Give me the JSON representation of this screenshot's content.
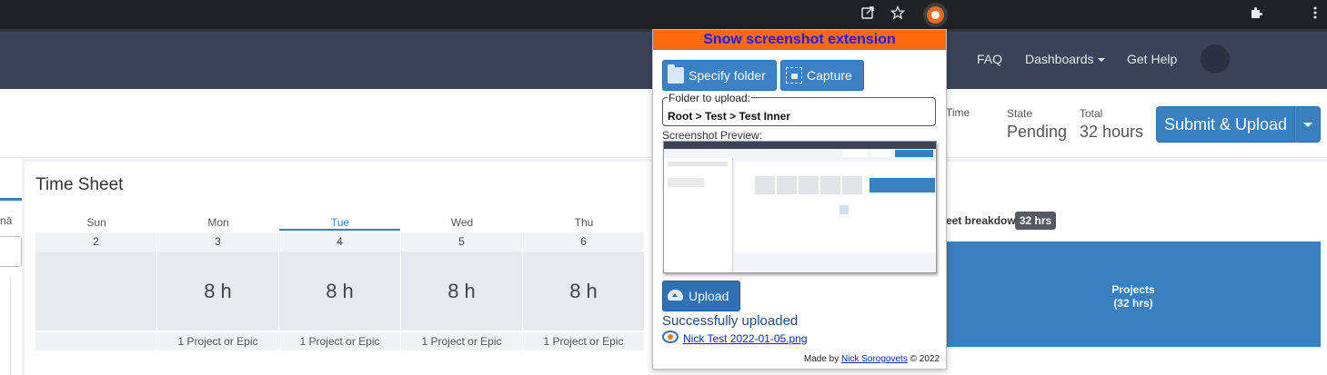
{
  "browser": {
    "icons": [
      "share-icon",
      "star-icon",
      "extension-snow-icon",
      "puzzle-icon",
      "kebab-menu-icon"
    ]
  },
  "nav": {
    "items": [
      {
        "label": "FAQ"
      },
      {
        "label": "Dashboards"
      },
      {
        "label": "Get Help"
      }
    ]
  },
  "header": {
    "time_label": "Time",
    "state_label": "State",
    "state_value": "Pending",
    "total_label": "Total",
    "total_value": "32 hours",
    "submit_label": "Submit & Upload"
  },
  "left_panel": {
    "partial_text": "nā"
  },
  "timesheet": {
    "title": "Time Sheet",
    "days": [
      {
        "name": "Sun",
        "num": "2",
        "hours": "",
        "footer": ""
      },
      {
        "name": "Mon",
        "num": "3",
        "hours": "8 h",
        "footer": "1 Project or Epic"
      },
      {
        "name": "Tue",
        "num": "4",
        "hours": "8 h",
        "footer": "1 Project or Epic"
      },
      {
        "name": "Wed",
        "num": "5",
        "hours": "8 h",
        "footer": "1 Project or Epic"
      },
      {
        "name": "Thu",
        "num": "6",
        "hours": "8 h",
        "footer": "1 Project or Epic"
      }
    ],
    "active_day": "Tue",
    "breakdown_label": "eet breakdown",
    "breakdown_badge": "32 hrs",
    "projects_label": "Projects",
    "projects_hours": "(32 hrs)"
  },
  "popup": {
    "title": "Snow screenshot extension",
    "specify_folder_label": "Specify folder",
    "capture_label": "Capture",
    "folder_legend": "Folder to upload:",
    "folder_path": "Root > Test > Test Inner",
    "preview_label": "Screenshot Preview:",
    "upload_label": "Upload",
    "success_text": "Successfully uploaded",
    "file_name": "Nick Test 2022-01-05.png",
    "made_by_prefix": "Made by ",
    "author": "Nick Sorogovets",
    "made_by_suffix": " © 2022"
  },
  "colors": {
    "accent": "#3a7fc0",
    "navbar": "#3b4358",
    "popup_header": "#ff6a0e",
    "popup_title": "#1c1cf0"
  }
}
